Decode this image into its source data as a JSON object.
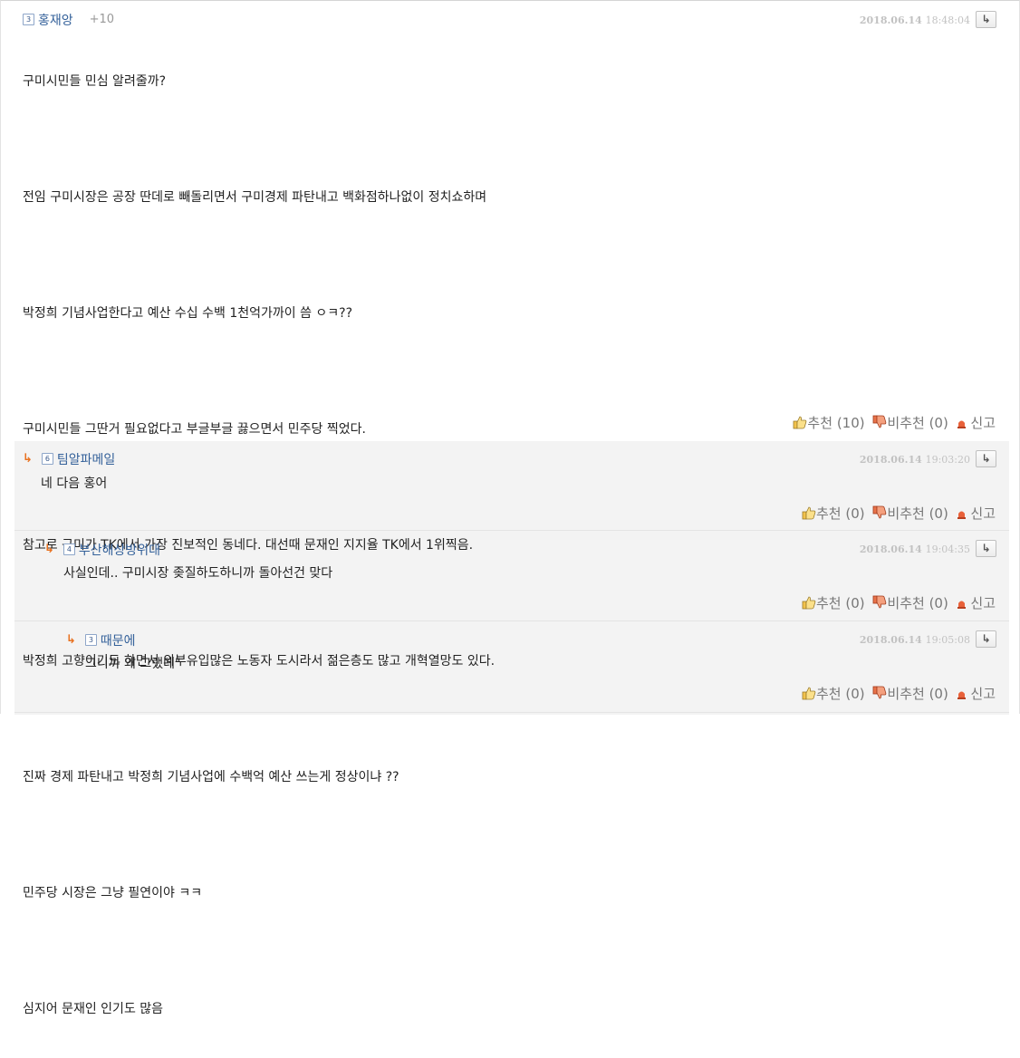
{
  "reply_arrow": "↳",
  "comments": [
    {
      "level": "3",
      "user": "홍재앙",
      "votes": "+10",
      "date": "2018.06.14",
      "time": "18:48:04",
      "lines": [
        "구미시민들 민심 알려줄까?",
        "",
        "전임 구미시장은 공장 딴데로 빼돌리면서 구미경제 파탄내고 백화점하나없이 정치쇼하며",
        "",
        "박정희 기념사업한다고 예산 수십 수백 1천억가까이 씀 ㅇㅋ??",
        "",
        "구미시민들 그딴거 필요없다고 부글부글 끓으면서 민주당 찍었다.",
        "",
        "참고로 구미가 TK에서 가장 진보적인 동네다. 대선때 문재인 지지율 TK에서 1위찍음.",
        "",
        "박정희 고향이기도 하면서 외부유입많은 노동자 도시라서 젊은층도 많고 개혁열망도 있다.",
        "",
        "진짜 경제 파탄내고 박정희 기념사업에 수백억 예산 쓰는게 정상이냐 ??",
        "",
        "민주당 시장은 그냥 필연이야 ㅋㅋ",
        "",
        "심지어 문재인 인기도 많음"
      ],
      "like_label": "추천",
      "like_count": "(10)",
      "dislike_label": "비추천",
      "dislike_count": "(0)",
      "report_label": "신고"
    },
    {
      "level": "6",
      "user": "팀알파메일",
      "date": "2018.06.14",
      "time": "19:03:20",
      "lines": [
        "네 다음 홍어"
      ],
      "like_label": "추천",
      "like_count": "(0)",
      "dislike_label": "비추천",
      "dislike_count": "(0)",
      "report_label": "신고"
    },
    {
      "level": "4",
      "user": "부산해상방위대",
      "date": "2018.06.14",
      "time": "19:04:35",
      "lines": [
        "사실인데.. 구미시장 좆질하도하니까 돌아선건 맞다"
      ],
      "like_label": "추천",
      "like_count": "(0)",
      "dislike_label": "비추천",
      "dislike_count": "(0)",
      "report_label": "신고"
    },
    {
      "level": "3",
      "user": "때문에",
      "date": "2018.06.14",
      "time": "19:05:08",
      "lines": [
        "그니까 왜 그랬데\""
      ],
      "like_label": "추천",
      "like_count": "(0)",
      "dislike_label": "비추천",
      "dislike_count": "(0)",
      "report_label": "신고"
    }
  ]
}
